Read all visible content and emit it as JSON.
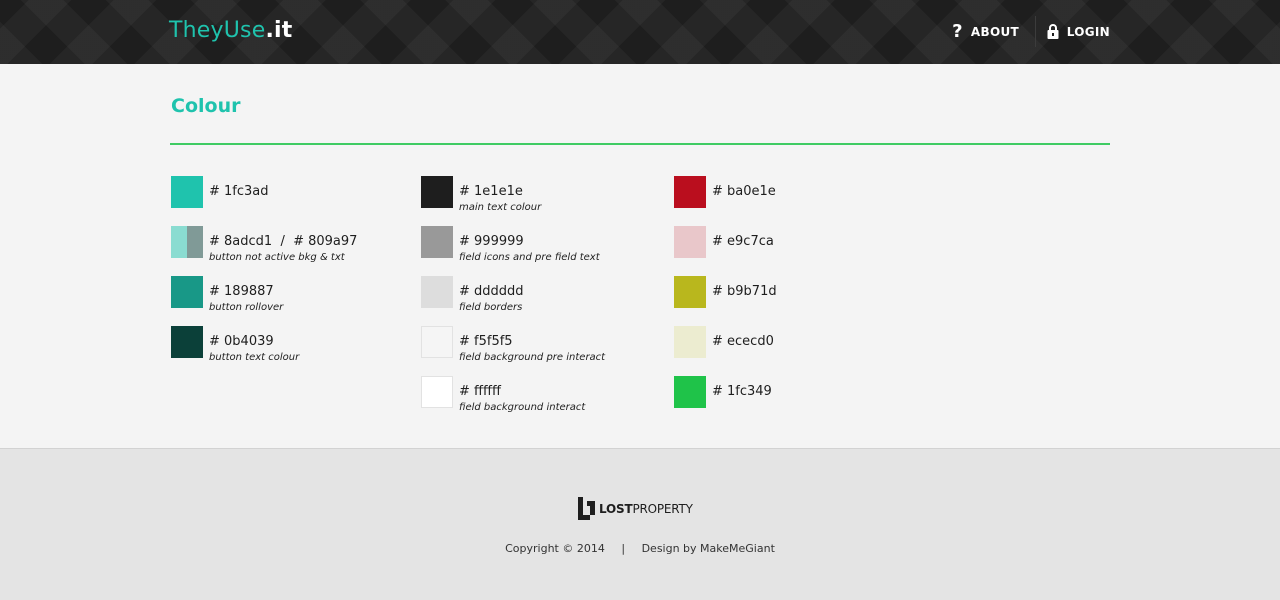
{
  "header": {
    "logo_brand": "TheyUse",
    "logo_tld": ".it",
    "nav": {
      "about_label": "ABOUT",
      "about_icon": "question-icon",
      "login_label": "LOGIN",
      "login_icon": "lock-icon"
    }
  },
  "main": {
    "title": "Colour",
    "columns": [
      [
        {
          "hex": "# 1fc3ad",
          "note": "",
          "colors": [
            "#1fc3ad"
          ]
        },
        {
          "hex": "# 8adcd1  /  # 809a97",
          "note": "button not active bkg & txt",
          "colors": [
            "#8adcd1",
            "#809a97"
          ]
        },
        {
          "hex": "# 189887",
          "note": "button rollover",
          "colors": [
            "#189887"
          ]
        },
        {
          "hex": "# 0b4039",
          "note": "button text colour",
          "colors": [
            "#0b4039"
          ]
        }
      ],
      [
        {
          "hex": "# 1e1e1e",
          "note": "main text colour",
          "colors": [
            "#1e1e1e"
          ]
        },
        {
          "hex": "# 999999",
          "note": "field icons and pre field text",
          "colors": [
            "#999999"
          ]
        },
        {
          "hex": "# dddddd",
          "note": "field borders",
          "colors": [
            "#dddddd"
          ]
        },
        {
          "hex": "# f5f5f5",
          "note": "field background pre interact",
          "colors": [
            "#f5f5f5"
          ]
        },
        {
          "hex": "# ffffff",
          "note": "field background interact",
          "colors": [
            "#ffffff"
          ]
        }
      ],
      [
        {
          "hex": "# ba0e1e",
          "note": "",
          "colors": [
            "#ba0e1e"
          ]
        },
        {
          "hex": "# e9c7ca",
          "note": "",
          "colors": [
            "#e9c7ca"
          ]
        },
        {
          "hex": "# b9b71d",
          "note": "",
          "colors": [
            "#b9b71d"
          ]
        },
        {
          "hex": "# ececd0",
          "note": "",
          "colors": [
            "#ececd0"
          ]
        },
        {
          "hex": "# 1fc349",
          "note": "",
          "colors": [
            "#1fc349"
          ]
        }
      ]
    ]
  },
  "footer": {
    "logo_bold": "LOST",
    "logo_rest": "PROPERTY",
    "copyright": "Copyright © 2014",
    "separator": "|",
    "design_credit": "Design by MakeMeGiant"
  },
  "colors": {
    "accent": "#1fc3ad",
    "rule": "#1fc349",
    "header_bg": "#1e1e1e"
  }
}
